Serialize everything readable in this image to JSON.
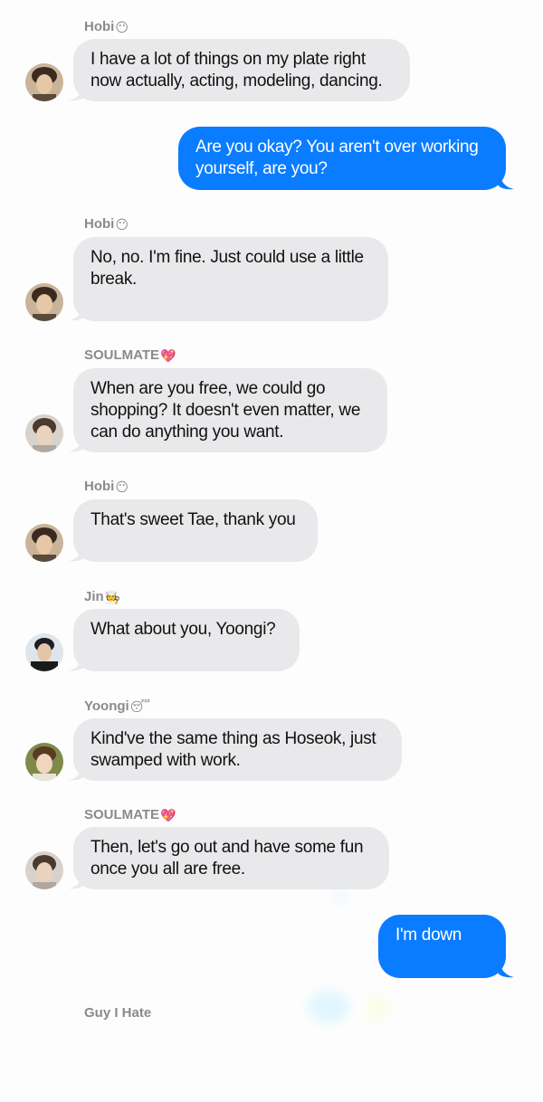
{
  "messages": [
    {
      "sender": "Hobi",
      "sender_emoji": "😶",
      "text": "I have a lot of things on my plate right now actually, acting, modeling, dancing.",
      "direction": "in"
    },
    {
      "text": "Are you okay? You aren't over working yourself, are you?",
      "direction": "out"
    },
    {
      "sender": "Hobi",
      "sender_emoji": "😶",
      "text": "No, no. I'm fine. Just could use a little break.",
      "direction": "in"
    },
    {
      "sender": "SOULMATE",
      "sender_emoji": "💖",
      "text": "When are you free, we could go shopping? It doesn't even matter, we can do anything you want.",
      "direction": "in"
    },
    {
      "sender": "Hobi",
      "sender_emoji": "😶",
      "text": "That's sweet Tae, thank you",
      "direction": "in"
    },
    {
      "sender": "Jin",
      "sender_emoji": "🧑‍🍳",
      "text": "What about you, Yoongi?",
      "direction": "in"
    },
    {
      "sender": "Yoongi",
      "sender_emoji": "😴",
      "text": "Kind've the same thing as Hoseok, just swamped with work.",
      "direction": "in"
    },
    {
      "sender": "SOULMATE",
      "sender_emoji": "💖",
      "text": "Then, let's go out and have some fun once you all are free.",
      "direction": "in"
    },
    {
      "text": "I'm down",
      "direction": "out"
    }
  ],
  "pending_sender": {
    "sender": "Guy I Hate"
  },
  "colors": {
    "incoming": "#e9e9eb",
    "outgoing": "#0a7cff",
    "sender_label": "#8a8a8e"
  }
}
